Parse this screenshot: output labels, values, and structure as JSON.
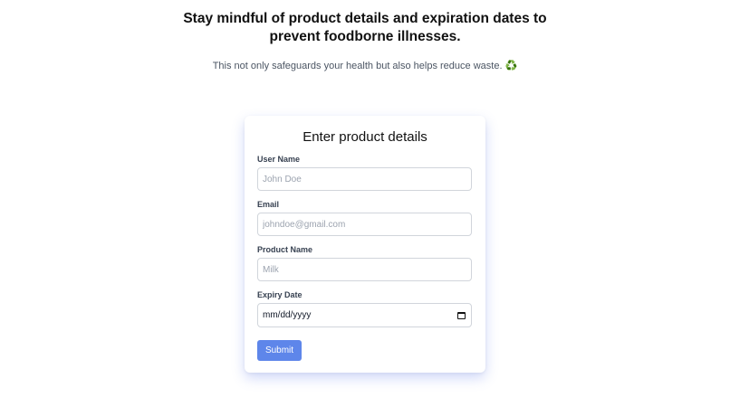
{
  "header": {
    "headline_line1": "Stay mindful of product details and expiration dates to",
    "headline_line2": "prevent foodborne illnesses.",
    "subline": "This not only safeguards your health but also helps reduce waste.",
    "subline_icon": "recycle-icon"
  },
  "form": {
    "title": "Enter product details",
    "fields": [
      {
        "label": "User Name",
        "placeholder": "John Doe",
        "value": ""
      },
      {
        "label": "Email",
        "placeholder": "johndoe@gmail.com",
        "value": ""
      },
      {
        "label": "Product Name",
        "placeholder": "Milk",
        "value": ""
      },
      {
        "label": "Expiry Date",
        "value": "mm/dd/yyyy"
      }
    ],
    "submit_label": "Submit",
    "accent_color": "#5e86ea"
  }
}
